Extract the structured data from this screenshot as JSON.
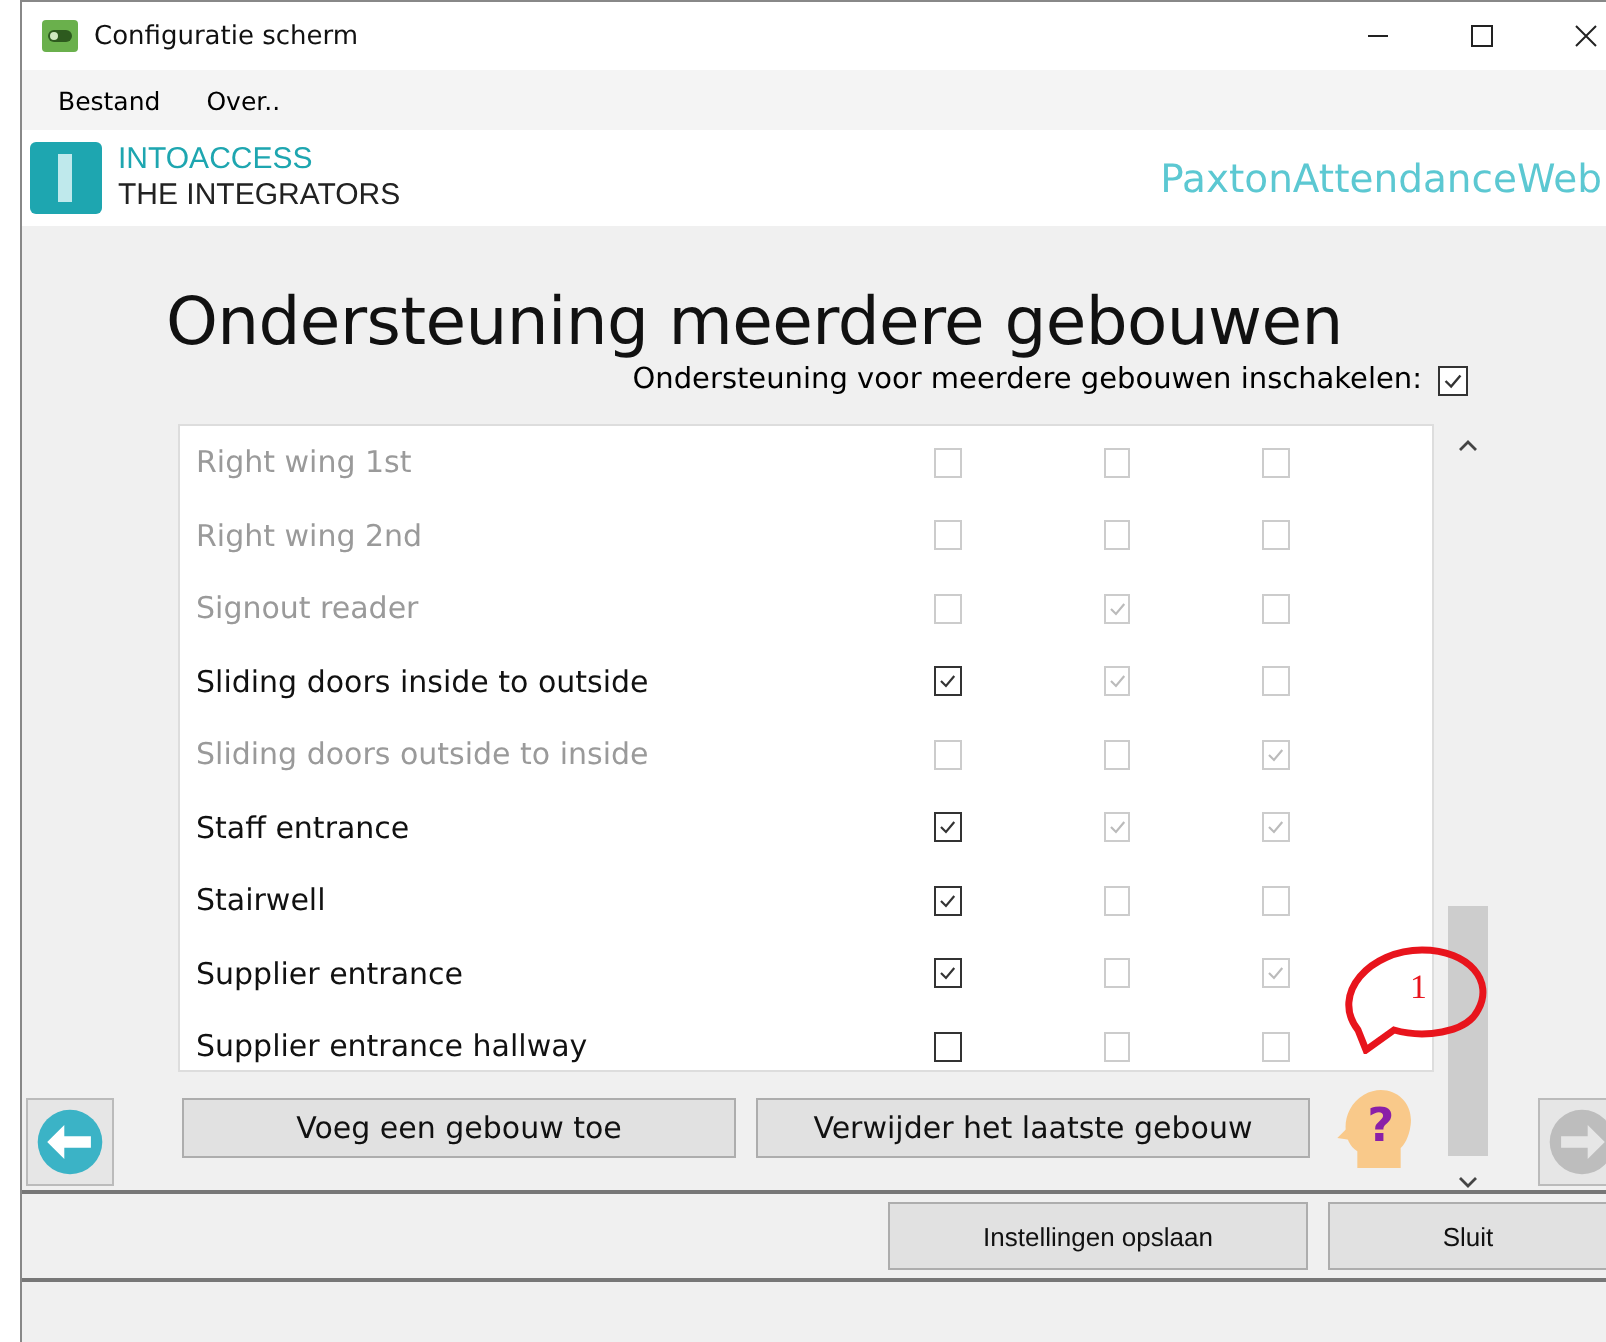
{
  "window": {
    "title": "Configuratie scherm"
  },
  "menu": [
    "Bestand",
    "Over.."
  ],
  "logo": {
    "line_1": "INTOACCESS",
    "line_2": "THE INTEGRATORS"
  },
  "app_name": "PaxtonAttendanceWeb",
  "heading": "Ondersteuning meerdere gebouwen",
  "enable_toggle": {
    "label": "Ondersteuning voor meerdere gebouwen inschakelen:",
    "checked": true
  },
  "doors": [
    {
      "name": "Right wing 1st",
      "disabled": true,
      "checks": [
        {
          "checked": false,
          "disabled": true
        },
        {
          "checked": false,
          "disabled": true
        },
        {
          "checked": false,
          "disabled": true
        }
      ]
    },
    {
      "name": "Right wing 2nd",
      "disabled": true,
      "checks": [
        {
          "checked": false,
          "disabled": true
        },
        {
          "checked": false,
          "disabled": true
        },
        {
          "checked": false,
          "disabled": true
        }
      ]
    },
    {
      "name": "Signout reader",
      "disabled": true,
      "checks": [
        {
          "checked": false,
          "disabled": true
        },
        {
          "checked": true,
          "disabled": true
        },
        {
          "checked": false,
          "disabled": true
        }
      ]
    },
    {
      "name": "Sliding doors inside to outside",
      "disabled": false,
      "checks": [
        {
          "checked": true,
          "disabled": false
        },
        {
          "checked": true,
          "disabled": true
        },
        {
          "checked": false,
          "disabled": true
        }
      ]
    },
    {
      "name": "Sliding doors outside to inside",
      "disabled": true,
      "checks": [
        {
          "checked": false,
          "disabled": true
        },
        {
          "checked": false,
          "disabled": true
        },
        {
          "checked": true,
          "disabled": true
        }
      ]
    },
    {
      "name": "Staff entrance",
      "disabled": false,
      "checks": [
        {
          "checked": true,
          "disabled": false
        },
        {
          "checked": true,
          "disabled": true
        },
        {
          "checked": true,
          "disabled": true
        }
      ]
    },
    {
      "name": "Stairwell",
      "disabled": false,
      "checks": [
        {
          "checked": true,
          "disabled": false
        },
        {
          "checked": false,
          "disabled": true
        },
        {
          "checked": false,
          "disabled": true
        }
      ]
    },
    {
      "name": "Supplier entrance",
      "disabled": false,
      "checks": [
        {
          "checked": true,
          "disabled": false
        },
        {
          "checked": false,
          "disabled": true
        },
        {
          "checked": true,
          "disabled": true
        }
      ]
    },
    {
      "name": "Supplier entrance hallway",
      "disabled": false,
      "checks": [
        {
          "checked": false,
          "disabled": false
        },
        {
          "checked": false,
          "disabled": true
        },
        {
          "checked": false,
          "disabled": true
        }
      ]
    }
  ],
  "buttons": [
    "Voeg een gebouw toe",
    "Verwijder het laatste gebouw"
  ],
  "callout": "1",
  "help_mark": "?",
  "footer_buttons": [
    "Instellingen opslaan",
    "Sluit"
  ]
}
